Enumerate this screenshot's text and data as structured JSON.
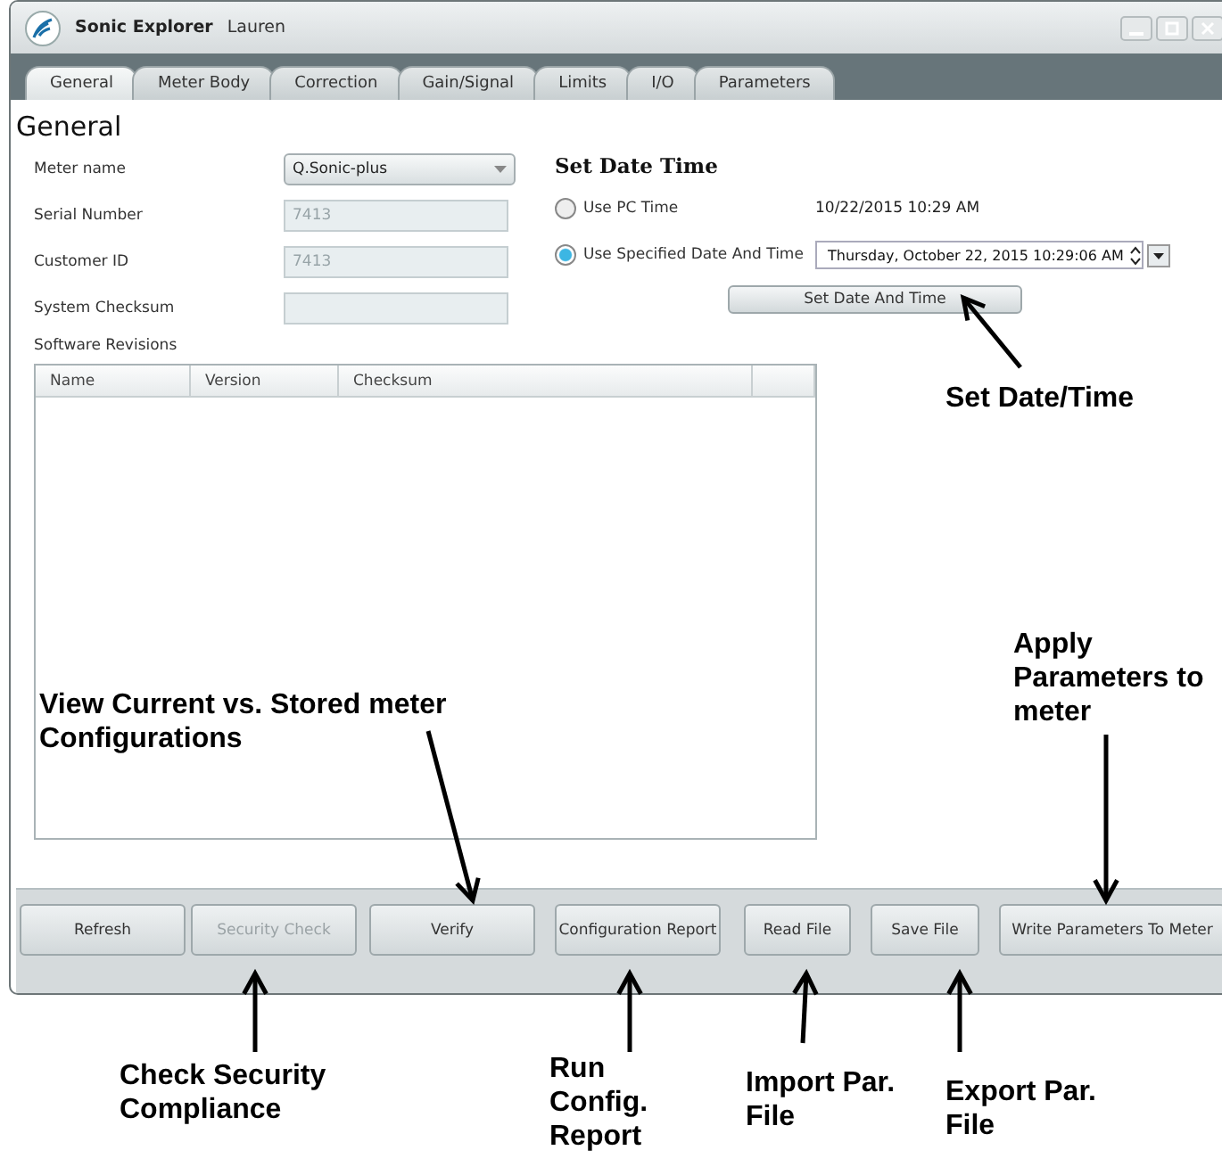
{
  "window": {
    "title": "Sonic Explorer",
    "user": "Lauren"
  },
  "tabs": [
    {
      "label": "General",
      "selected": true
    },
    {
      "label": "Meter Body",
      "selected": false
    },
    {
      "label": "Correction",
      "selected": false
    },
    {
      "label": "Gain/Signal",
      "selected": false
    },
    {
      "label": "Limits",
      "selected": false
    },
    {
      "label": "I/O",
      "selected": false
    },
    {
      "label": "Parameters",
      "selected": false
    }
  ],
  "heading": "General",
  "fields": [
    {
      "label": "Meter name",
      "kind": "dropdown",
      "value": "Q.Sonic-plus",
      "disabled": false
    },
    {
      "label": "Serial Number",
      "kind": "text",
      "value": "7413",
      "disabled": true
    },
    {
      "label": "Customer ID",
      "kind": "text",
      "value": "7413",
      "disabled": true
    },
    {
      "label": "System Checksum",
      "kind": "text",
      "disabled": true
    }
  ],
  "date_time": {
    "title": "Set Date Time",
    "options": [
      {
        "label": "Use PC Time",
        "selected": false,
        "value": "10/22/2015 10:29 AM",
        "kind": "readout"
      },
      {
        "label": "Use Specified Date And Time",
        "selected": true,
        "value": "Thursday, October 22, 2015 10:29:06 AM",
        "kind": "picker"
      }
    ],
    "button": "Set Date And Time"
  },
  "software_revisions": {
    "title": "Software Revisions",
    "columns": [
      "Name",
      "Version",
      "Checksum"
    ]
  },
  "buttons": [
    {
      "label": "Refresh",
      "disabled": false
    },
    {
      "label": "Security Check",
      "disabled": true
    },
    {
      "label": "Verify",
      "disabled": false
    },
    {
      "label": "Configuration Report",
      "disabled": false
    },
    {
      "label": "Read File",
      "disabled": false
    },
    {
      "label": "Save File",
      "disabled": false
    },
    {
      "label": "Write Parameters To Meter",
      "disabled": false
    }
  ],
  "annotations": [
    "Set Date/Time",
    "View Current vs. Stored meter Configurations",
    "Apply Parameters to meter",
    "Check Security Compliance",
    "Run Config. Report",
    "Import Par. File",
    "Export Par. File"
  ]
}
